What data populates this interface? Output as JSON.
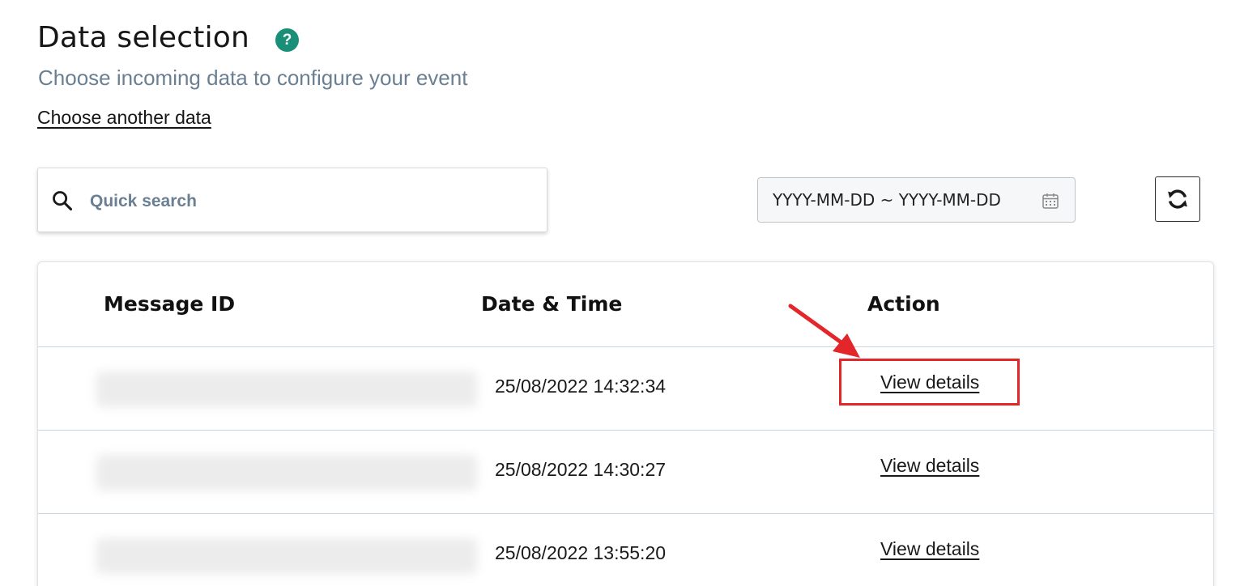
{
  "header": {
    "title": "Data selection",
    "help_glyph": "?",
    "subtitle": "Choose incoming data to configure your event",
    "choose_link": "Choose another data"
  },
  "search": {
    "placeholder": "Quick search",
    "value": "",
    "icon": "search-icon"
  },
  "date_filter": {
    "value": "YYYY-MM-DD ~ YYYY-MM-DD",
    "icon": "calendar-icon"
  },
  "refresh": {
    "icon": "refresh-icon"
  },
  "table": {
    "columns": [
      "Message ID",
      "Date & Time",
      "Action"
    ],
    "rows": [
      {
        "message_id": "",
        "datetime": "25/08/2022 14:32:34",
        "action": "View details"
      },
      {
        "message_id": "",
        "datetime": "25/08/2022 14:30:27",
        "action": "View details"
      },
      {
        "message_id": "",
        "datetime": "25/08/2022 13:55:20",
        "action": "View details"
      }
    ]
  },
  "annotation": {
    "highlight_color": "#e3262a",
    "target": "View details"
  },
  "colors": {
    "accent": "#1a8f78",
    "subtitle": "#6b7f92",
    "row_divider": "#c9d6dd"
  }
}
